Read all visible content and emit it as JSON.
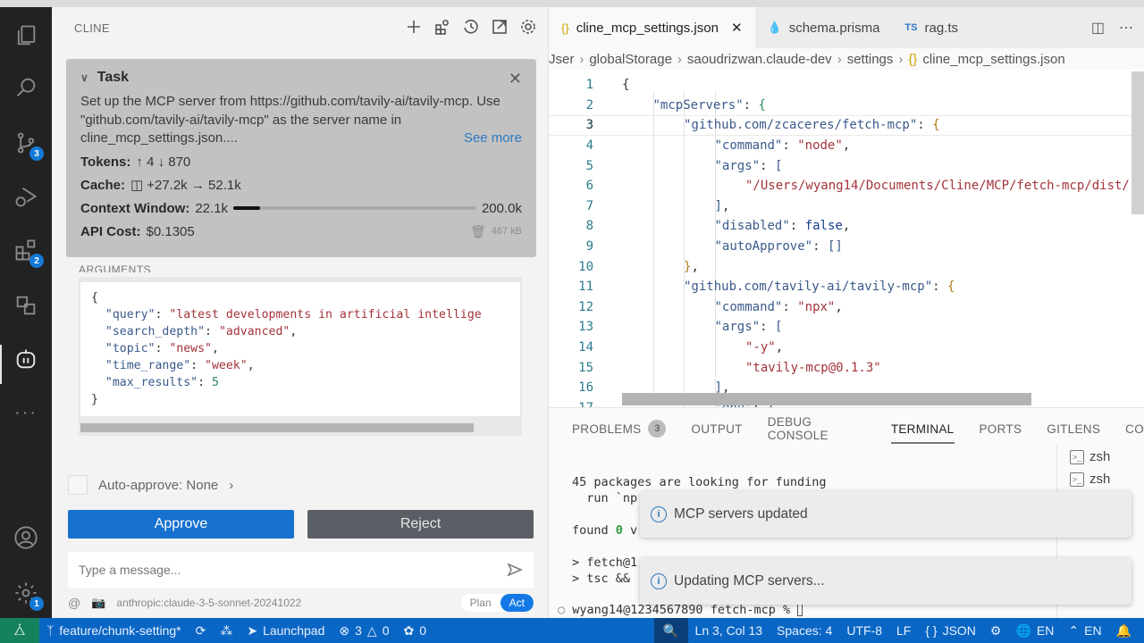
{
  "activity_bar": {
    "items": [
      {
        "name": "explorer",
        "icon": "files-icon"
      },
      {
        "name": "search",
        "icon": "search-icon"
      },
      {
        "name": "source-control",
        "icon": "source-control-icon",
        "badge": "3"
      },
      {
        "name": "run-debug",
        "icon": "run-debug-icon"
      },
      {
        "name": "extensions",
        "icon": "extensions-icon",
        "badge": "2"
      },
      {
        "name": "translate",
        "icon": "translate-icon"
      },
      {
        "name": "cline",
        "icon": "robot-icon",
        "active": true
      },
      {
        "name": "more",
        "icon": "ellipsis-icon"
      }
    ],
    "bottom": [
      {
        "name": "accounts",
        "icon": "account-icon"
      },
      {
        "name": "manage",
        "icon": "gear-icon",
        "badge": "1"
      }
    ]
  },
  "sidebar": {
    "title": "CLINE",
    "actions": [
      "new-task",
      "mcp-servers",
      "history",
      "popout",
      "settings"
    ],
    "task": {
      "heading": "Task",
      "description": "Set up the MCP server from https://github.com/tavily-ai/tavily-mcp. Use \"github.com/tavily-ai/tavily-mcp\" as the server name in cline_mcp_settings.json....",
      "see_more": "See more",
      "tokens_label": "Tokens:",
      "tokens_value": "↑ 4 ↓ 870",
      "cache_label": "Cache:",
      "cache_value": "+27.2k → 52.1k",
      "context_label": "Context Window:",
      "context_used": "22.1k",
      "context_max": "200.0k",
      "context_fraction": 0.11,
      "cost_label": "API Cost:",
      "cost_value": "$0.1305",
      "storage_size": "467 kB"
    },
    "arguments_label": "ARGUMENTS",
    "arguments": [
      {
        "key": "\"query\"",
        "value": "\"latest developments in artificial intellige",
        "type": "s",
        "comma": ""
      },
      {
        "key": "\"search_depth\"",
        "value": "\"advanced\"",
        "type": "s",
        "comma": ","
      },
      {
        "key": "\"topic\"",
        "value": "\"news\"",
        "type": "s",
        "comma": ","
      },
      {
        "key": "\"time_range\"",
        "value": "\"week\"",
        "type": "s",
        "comma": ","
      },
      {
        "key": "\"max_results\"",
        "value": "5",
        "type": "n",
        "comma": ""
      }
    ],
    "auto_approve": "Auto-approve: None",
    "approve_label": "Approve",
    "reject_label": "Reject",
    "message_placeholder": "Type a message...",
    "model": "anthropic:claude-3-5-sonnet-20241022",
    "plan_label": "Plan",
    "act_label": "Act"
  },
  "editor": {
    "tabs": [
      {
        "label": "cline_mcp_settings.json",
        "icon": "{}",
        "active": true
      },
      {
        "label": "schema.prisma",
        "icon": "◆",
        "active": false
      },
      {
        "label": "rag.ts",
        "icon": "TS",
        "active": false
      }
    ],
    "breadcrumbs": [
      "Jser",
      "globalStorage",
      "saoudrizwan.claude-dev",
      "settings",
      "cline_mcp_settings.json"
    ],
    "lines": [
      {
        "n": "1",
        "indent": 0,
        "html": "<span class='p'>{</span>"
      },
      {
        "n": "2",
        "indent": 1,
        "html": "<span class='k'>\"mcpServers\"</span>: <span style='color:#2b8a5a'>{</span>"
      },
      {
        "n": "3",
        "indent": 2,
        "html": "<span class='k'>\"github.com/zcaceres/fetch-mcp\"</span>: <span style='color:#b07a1a'>{</span>"
      },
      {
        "n": "4",
        "indent": 3,
        "html": "<span class='k'>\"command\"</span>: <span class='s'>\"node\"</span>,"
      },
      {
        "n": "5",
        "indent": 3,
        "html": "<span class='k'>\"args\"</span>: <span class='k'>[</span>"
      },
      {
        "n": "6",
        "indent": 4,
        "html": "<span class='s'>\"/Users/wyang14/Documents/Cline/MCP/fetch-mcp/dist/</span>"
      },
      {
        "n": "7",
        "indent": 3,
        "html": "<span class='k'>]</span>,"
      },
      {
        "n": "8",
        "indent": 3,
        "html": "<span class='k'>\"disabled\"</span>: <span style='color:#1a3f8a'>false</span>,"
      },
      {
        "n": "9",
        "indent": 3,
        "html": "<span class='k'>\"autoApprove\"</span>: <span class='k'>[]</span>"
      },
      {
        "n": "10",
        "indent": 2,
        "html": "<span style='color:#b07a1a'>}</span>,"
      },
      {
        "n": "11",
        "indent": 2,
        "html": "<span class='k'>\"github.com/tavily-ai/tavily-mcp\"</span>: <span style='color:#b07a1a'>{</span>"
      },
      {
        "n": "12",
        "indent": 3,
        "html": "<span class='k'>\"command\"</span>: <span class='s'>\"npx\"</span>,"
      },
      {
        "n": "13",
        "indent": 3,
        "html": "<span class='k'>\"args\"</span>: <span class='k'>[</span>"
      },
      {
        "n": "14",
        "indent": 4,
        "html": "<span class='s'>\"-y\"</span>,"
      },
      {
        "n": "15",
        "indent": 4,
        "html": "<span class='s'>\"tavily-mcp@0.1.3\"</span>"
      },
      {
        "n": "16",
        "indent": 3,
        "html": "<span class='k'>]</span>,"
      },
      {
        "n": "17",
        "indent": 3,
        "html": "<span class='k'>\"env\"</span>: <span class='k'>{</span>"
      }
    ],
    "current_line": "3"
  },
  "panel": {
    "tabs": [
      {
        "label": "PROBLEMS",
        "badge": "3"
      },
      {
        "label": "OUTPUT"
      },
      {
        "label": "DEBUG CONSOLE"
      },
      {
        "label": "TERMINAL",
        "active": true
      },
      {
        "label": "PORTS"
      },
      {
        "label": "GITLENS"
      },
      {
        "label": "CO"
      }
    ],
    "terminal_lines": [
      "45 packages are looking for funding",
      "  run `np",
      "",
      "found 0 v",
      "",
      "> fetch@1",
      "> tsc &&"
    ],
    "prompt": "wyang14@1234567890 fetch-mcp % ",
    "terminals": [
      "zsh",
      "zsh"
    ]
  },
  "notifications": [
    {
      "text": "MCP servers updated"
    },
    {
      "text": "Updating MCP servers..."
    }
  ],
  "status_bar": {
    "branch": "feature/chunk-setting*",
    "launchpad": "Launchpad",
    "errors": "3",
    "warnings": "0",
    "ports": "0",
    "position": "Ln 3, Col 13",
    "spaces": "Spaces: 4",
    "encoding": "UTF-8",
    "eol": "LF",
    "language": "JSON",
    "lang1": "EN",
    "lang2": "EN"
  }
}
